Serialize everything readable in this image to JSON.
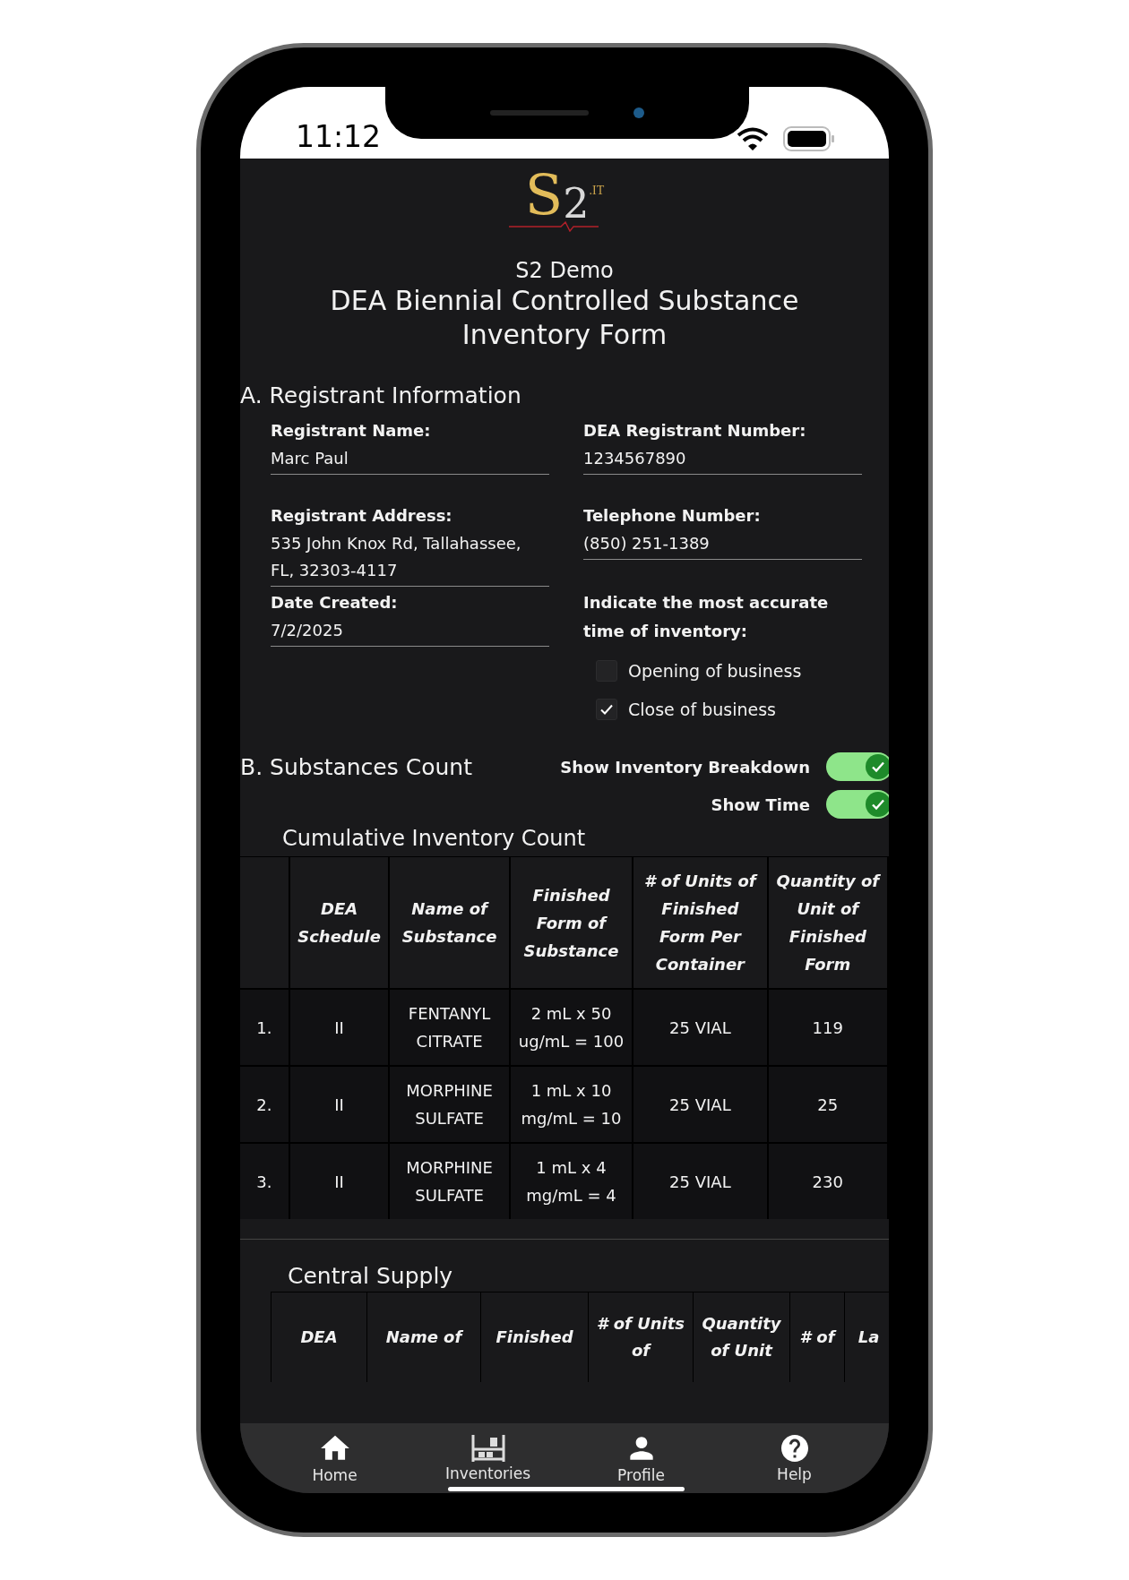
{
  "status_bar": {
    "time": "11:12"
  },
  "logo": {
    "letter": "S",
    "digit": "2",
    "suffix": ".IT"
  },
  "header": {
    "organization": "S2 Demo",
    "title": "DEA Biennial Controlled Substance Inventory Form"
  },
  "registrant_information": {
    "heading": "A. Registrant Information",
    "rows": [
      [
        {
          "kind": "field",
          "label": "Registrant Name:",
          "value": "Marc Paul"
        },
        {
          "kind": "field",
          "label": "DEA Registrant Number:",
          "value": "1234567890"
        }
      ],
      [
        {
          "kind": "field",
          "label": "Registrant Address:",
          "value": "535 John Knox Rd, Tallahassee, FL, 32303-4117"
        },
        {
          "kind": "field",
          "label": "Telephone Number:",
          "value": "(850) 251-1389"
        }
      ],
      [
        {
          "kind": "field",
          "label": "Date Created:",
          "value": "7/2/2025"
        },
        {
          "kind": "choice",
          "label": "Indicate the most accurate time of inventory:",
          "options": [
            {
              "label": "Opening of business",
              "checked": false
            },
            {
              "label": "Close of business",
              "checked": true
            }
          ]
        }
      ]
    ]
  },
  "substances_count": {
    "heading": "B. Substances Count",
    "toggles": [
      {
        "label": "Show Inventory Breakdown",
        "on": true
      },
      {
        "label": "Show Time",
        "on": true
      }
    ]
  },
  "cumulative_table": {
    "title": "Cumulative Inventory Count",
    "columns": [
      "",
      "DEA Schedule",
      "Name of Substance",
      "Finished Form of Substance",
      "# of Units of Finished Form Per Container",
      "Quantity of Unit of Finished Form"
    ],
    "rows": [
      [
        "1.",
        "II",
        "FENTANYL CITRATE",
        "2 mL x 50 ug/mL = 100",
        "25 VIAL",
        "119"
      ],
      [
        "2.",
        "II",
        "MORPHINE SULFATE",
        "1 mL x 10 mg/mL = 10",
        "25 VIAL",
        "25"
      ],
      [
        "3.",
        "II",
        "MORPHINE SULFATE",
        "1 mL x 4 mg/mL = 4",
        "25 VIAL",
        "230"
      ]
    ]
  },
  "central_supply_table": {
    "title": "Central Supply",
    "columns": [
      "DEA",
      "Name of",
      "Finished",
      "# of Units of",
      "Quantity of Unit",
      "# of",
      "La"
    ]
  },
  "tab_bar": [
    {
      "label": "Home"
    },
    {
      "label": "Inventories"
    },
    {
      "label": "Profile"
    },
    {
      "label": "Help"
    }
  ]
}
